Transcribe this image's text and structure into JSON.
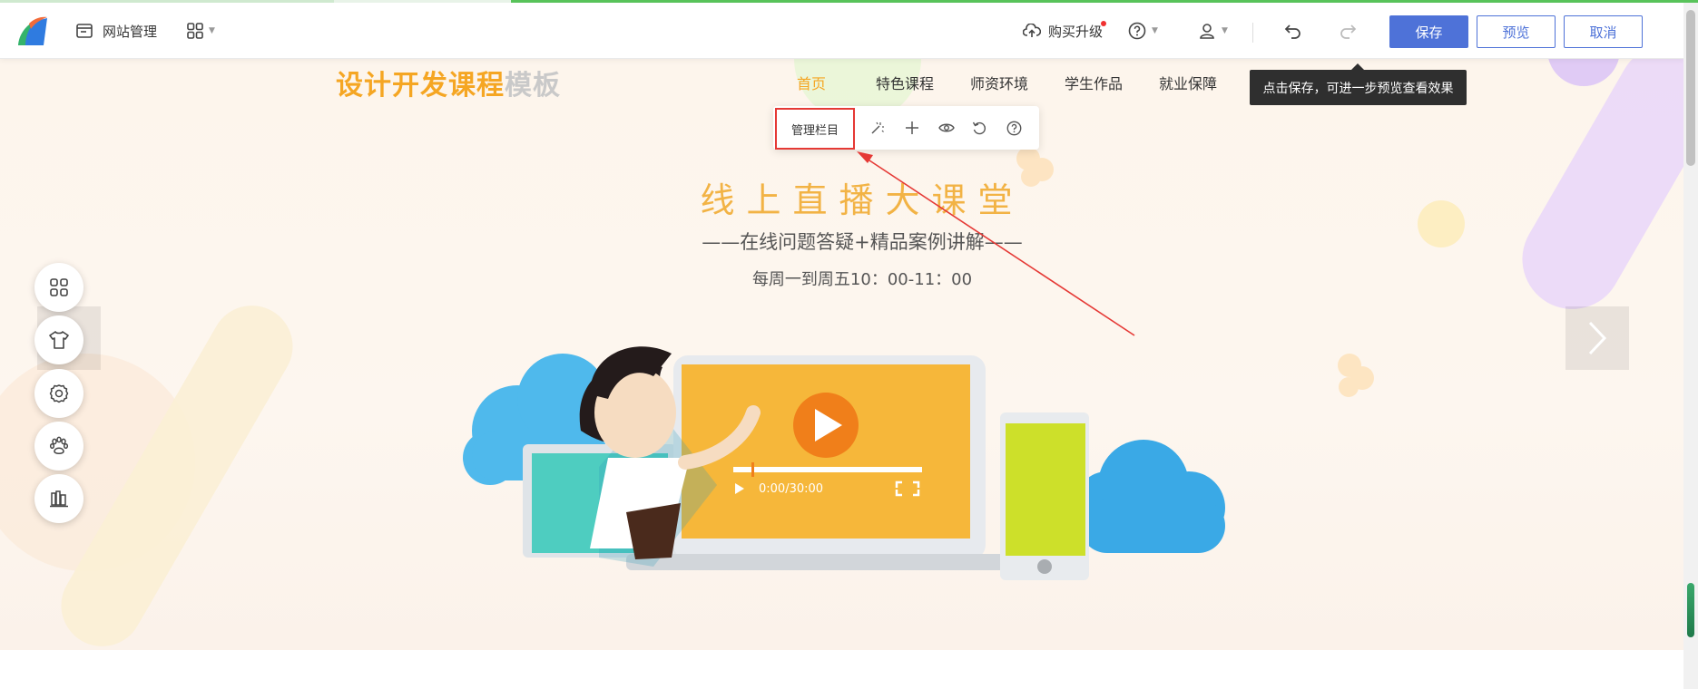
{
  "toolbar": {
    "site_manage_label": "网站管理",
    "upgrade_label": "购买升级",
    "save_label": "保存",
    "preview_label": "预览",
    "cancel_label": "取消",
    "tooltip": "点击保存，可进一步预览查看效果"
  },
  "site": {
    "title_main": "设计开发课程",
    "title_suffix": "模板"
  },
  "nav": {
    "items": [
      "首页",
      "特色课程",
      "师资环境",
      "学生作品",
      "就业保障"
    ],
    "active_index": 0
  },
  "manage_bar": {
    "manage_label": "管理栏目"
  },
  "banner": {
    "headline": "线上直播大课堂",
    "subhead": "——在线问题答疑+精品案例讲解——",
    "schedule": "每周一到周五10：00-11：00",
    "video_time": "0:00/30:00"
  },
  "colors": {
    "accent": "#4e72d8",
    "title_orange": "#f5a623",
    "headline": "#f2b345",
    "highlight_red": "#e53935"
  },
  "icons": {
    "side_tools": [
      "grid-icon",
      "shirt-icon",
      "settings-icon",
      "paw-icon",
      "books-icon"
    ],
    "manage_bar": [
      "magic-wand-icon",
      "plus-icon",
      "eye-icon",
      "undo-icon",
      "help-icon"
    ]
  }
}
